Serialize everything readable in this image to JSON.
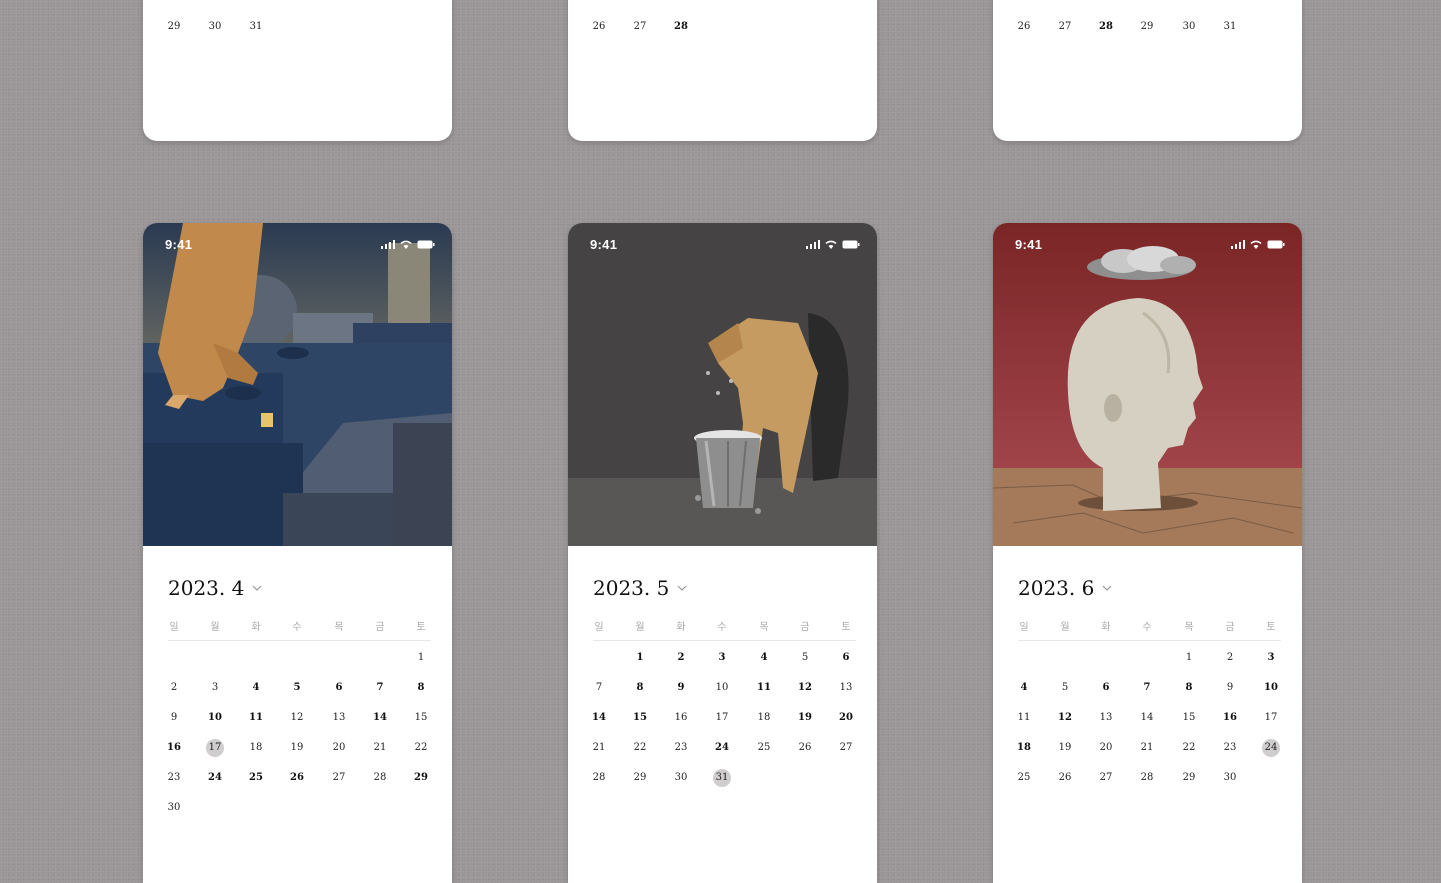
{
  "top_cards": [
    {
      "rows": [
        [
          {
            "d": "29"
          },
          {
            "d": "30"
          },
          {
            "d": "31"
          }
        ]
      ]
    },
    {
      "rows": [
        [
          {
            "d": "26"
          },
          {
            "d": "27"
          },
          {
            "d": "28",
            "bold": true
          }
        ]
      ]
    },
    {
      "rows": [
        [
          {
            "d": "26"
          },
          {
            "d": "27"
          },
          {
            "d": "28",
            "bold": true
          },
          {
            "d": "29"
          },
          {
            "d": "30"
          },
          {
            "d": "31"
          }
        ]
      ]
    }
  ],
  "status": {
    "time": "9:41"
  },
  "weekdays": [
    "일",
    "월",
    "화",
    "수",
    "목",
    "금",
    "토"
  ],
  "months": [
    {
      "title": "2023. 4",
      "start": 6,
      "days": 30,
      "highlight": 17,
      "bold": [
        4,
        5,
        6,
        7,
        8,
        10,
        11,
        14,
        16,
        24,
        25,
        26,
        29
      ]
    },
    {
      "title": "2023. 5",
      "start": 1,
      "days": 31,
      "highlight": 31,
      "bold": [
        1,
        2,
        3,
        4,
        6,
        8,
        9,
        11,
        12,
        14,
        15,
        19,
        20,
        24
      ]
    },
    {
      "title": "2023. 6",
      "start": 4,
      "days": 30,
      "highlight": 24,
      "bold": [
        3,
        4,
        6,
        7,
        8,
        10,
        12,
        16,
        18
      ]
    }
  ]
}
